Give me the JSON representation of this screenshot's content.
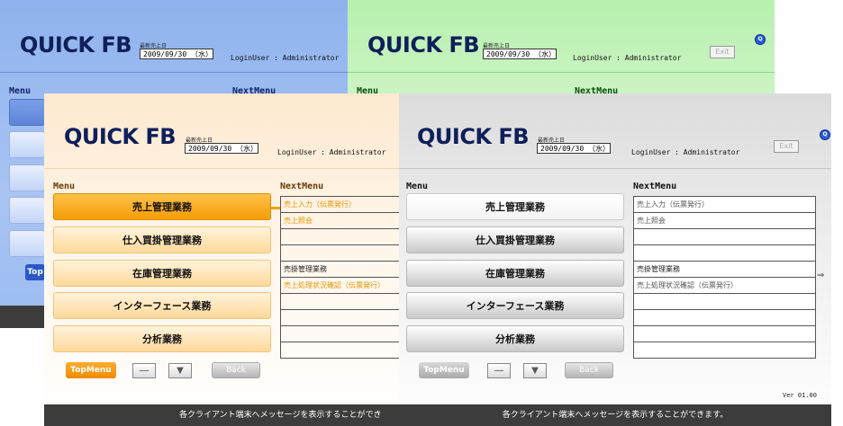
{
  "app": {
    "title": "QUICK FB",
    "date_caption": "最新売上日",
    "date_value": "2009/09/30 （水）",
    "login_text": "LoginUser : Administrator",
    "exit_label": "Exit",
    "help_icon": "q-help-icon",
    "menu_heading": "Menu",
    "nextmenu_heading": "NextMenu",
    "top_menu_label": "TopMenu",
    "top_menu_label_short": "Top",
    "nav_minus": "―",
    "nav_down": "▼",
    "back_label": "Back",
    "version": "Ver 01.00",
    "status_message": "各クライアント端末へメッセージを表示することができます。",
    "status_message_truncated": "各クライアント端末へメッセージを表示することができ"
  },
  "menu": {
    "items": [
      {
        "label": "売上管理業務"
      },
      {
        "label": "仕入買掛管理業務"
      },
      {
        "label": "在庫管理業務"
      },
      {
        "label": "インターフェース業務"
      },
      {
        "label": "分析業務"
      }
    ]
  },
  "nextmenu": {
    "items": [
      {
        "label": "売上入力（伝票発行）"
      },
      {
        "label": "売上照会"
      },
      {
        "label": ""
      },
      {
        "label": ""
      },
      {
        "label": "売掛管理業務"
      },
      {
        "label": "売上処理状況確認（伝票発行）"
      },
      {
        "label": ""
      },
      {
        "label": ""
      },
      {
        "label": ""
      },
      {
        "label": ""
      }
    ],
    "arrow": "⇒"
  },
  "colors": {
    "blue_theme": "#9bbbf0",
    "green_theme": "#c4f3bb",
    "orange_theme": "#f59d06",
    "gray_theme": "#dcdcdc"
  }
}
